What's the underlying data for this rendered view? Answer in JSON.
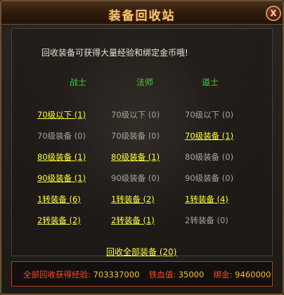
{
  "window": {
    "title": "装备回收站",
    "close_label": "X"
  },
  "intro": "回收装备可获得大量经验和绑定金币哦!",
  "columns": [
    {
      "header": "战士",
      "items": [
        {
          "label": "70级以下 (1)",
          "active": true
        },
        {
          "label": "70级装备 (0)",
          "active": false
        },
        {
          "label": "80级装备 (1)",
          "active": true
        },
        {
          "label": "90级装备 (1)",
          "active": true
        },
        {
          "label": "1转装备 (6)",
          "active": true
        },
        {
          "label": "2转装备 (2)",
          "active": true
        }
      ]
    },
    {
      "header": "法师",
      "items": [
        {
          "label": "70级以下 (0)",
          "active": false
        },
        {
          "label": "70级装备 (0)",
          "active": false
        },
        {
          "label": "80级装备 (1)",
          "active": true
        },
        {
          "label": "90级装备 (0)",
          "active": false
        },
        {
          "label": "1转装备 (2)",
          "active": true
        },
        {
          "label": "2转装备 (1)",
          "active": true
        }
      ]
    },
    {
      "header": "道士",
      "items": [
        {
          "label": "70级以下 (0)",
          "active": false
        },
        {
          "label": "70级装备 (1)",
          "active": true
        },
        {
          "label": "80级装备 (0)",
          "active": false
        },
        {
          "label": "90级装备 (0)",
          "active": false
        },
        {
          "label": "1转装备 (4)",
          "active": true
        },
        {
          "label": "2转装备 (0)",
          "active": false
        }
      ]
    }
  ],
  "recycle_all_label": "回收全部装备 (20)",
  "summary": {
    "exp_label": "全部回收获得经验:",
    "exp_value": "703337000",
    "iron_label": "铁血值:",
    "iron_value": "35000",
    "gold_label": "绑金:",
    "gold_value": "9460000"
  }
}
